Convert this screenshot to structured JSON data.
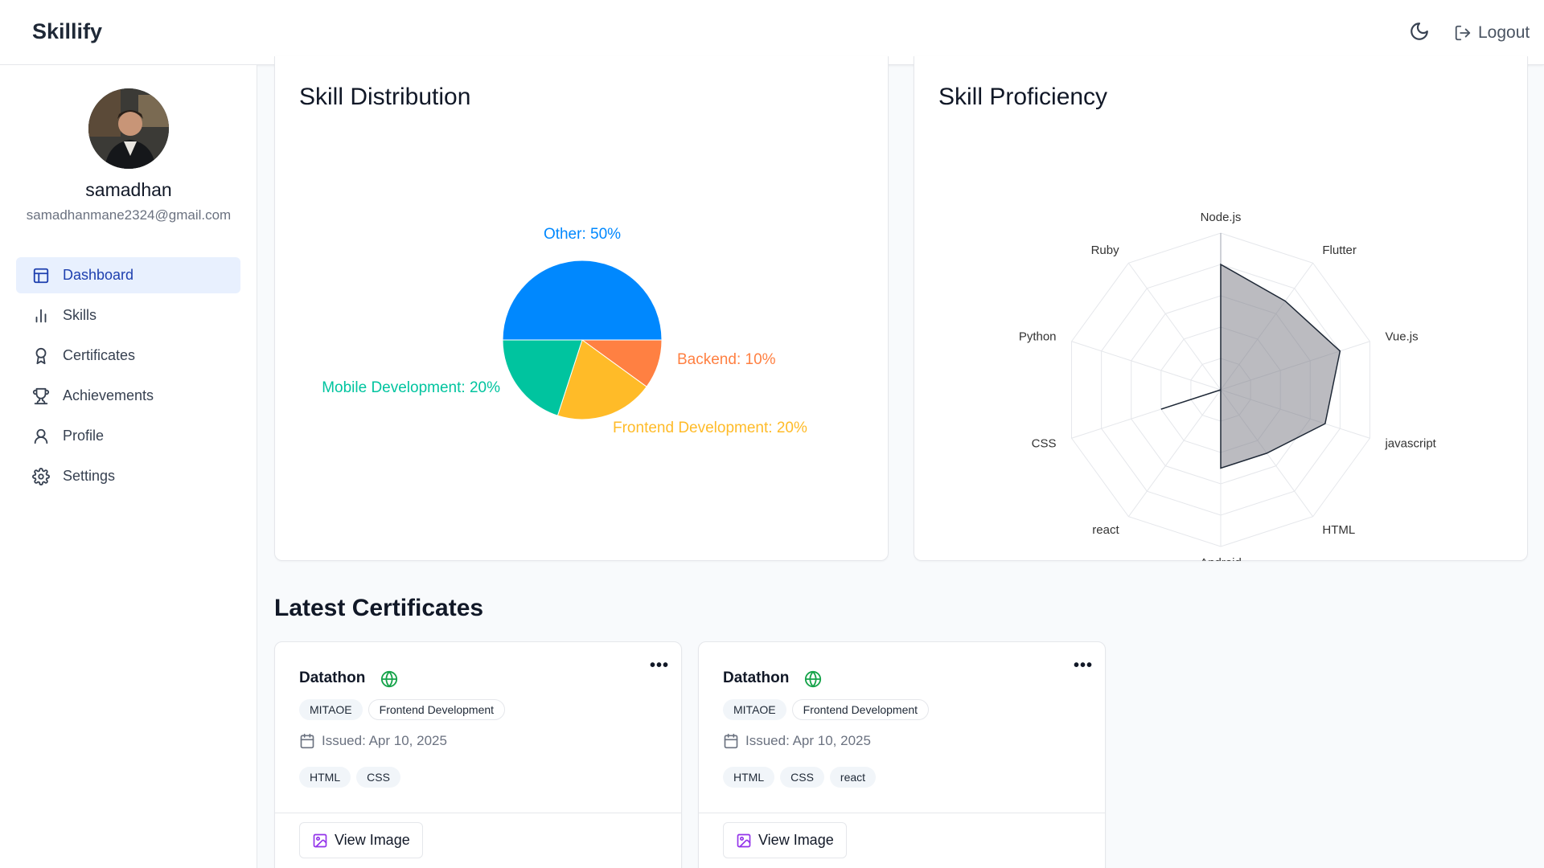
{
  "header": {
    "brand": "Skillify",
    "theme_icon": "moon-icon",
    "logout_label": "Logout",
    "logout_icon": "logout-icon"
  },
  "sidebar": {
    "user_name": "samadhan",
    "user_email": "samadhanmane2324@gmail.com",
    "items": [
      {
        "label": "Dashboard",
        "icon": "layout-icon",
        "active": true
      },
      {
        "label": "Skills",
        "icon": "bar-chart-icon",
        "active": false
      },
      {
        "label": "Certificates",
        "icon": "award-icon",
        "active": false
      },
      {
        "label": "Achievements",
        "icon": "trophy-icon",
        "active": false
      },
      {
        "label": "Profile",
        "icon": "user-icon",
        "active": false
      },
      {
        "label": "Settings",
        "icon": "gear-icon",
        "active": false
      }
    ]
  },
  "skill_distribution": {
    "title": "Skill Distribution"
  },
  "skill_proficiency": {
    "title": "Skill Proficiency"
  },
  "chart_data": [
    {
      "type": "pie",
      "title": "Skill Distribution",
      "slices": [
        {
          "label": "Other",
          "value": 50,
          "label_text": "Other: 50%",
          "color": "#0088fe"
        },
        {
          "label": "Backend",
          "value": 10,
          "label_text": "Backend: 10%",
          "color": "#ff8042"
        },
        {
          "label": "Frontend Development",
          "value": 20,
          "label_text": "Frontend Development: 20%",
          "color": "#ffbb28"
        },
        {
          "label": "Mobile Development",
          "value": 20,
          "label_text": "Mobile Development: 20%",
          "color": "#00c49f"
        }
      ]
    },
    {
      "type": "radar",
      "title": "Skill Proficiency",
      "axes": [
        "Node.js",
        "Flutter",
        "Vue.js",
        "javascript",
        "HTML",
        "Android",
        "react",
        "CSS",
        "Python",
        "Ruby"
      ],
      "values": [
        80,
        70,
        80,
        70,
        50,
        50,
        0,
        40,
        0,
        0
      ],
      "max": 100,
      "grid_levels": 5
    }
  ],
  "certificates": {
    "section_title": "Latest Certificates",
    "items": [
      {
        "title": "Datathon",
        "issuer": "MITAOE",
        "category": "Frontend Development",
        "issued": "Issued: Apr 10, 2025",
        "tags": [
          "HTML",
          "CSS"
        ],
        "button": "View Image",
        "menu": "•••"
      },
      {
        "title": "Datathon",
        "issuer": "MITAOE",
        "category": "Frontend Development",
        "issued": "Issued: Apr 10, 2025",
        "tags": [
          "HTML",
          "CSS",
          "react"
        ],
        "button": "View Image",
        "menu": "•••"
      }
    ]
  }
}
